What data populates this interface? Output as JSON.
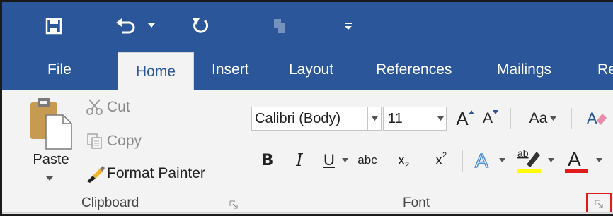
{
  "quick_access": {
    "save_icon": "save-icon",
    "undo_icon": "undo-icon",
    "redo_icon": "redo-icon",
    "disabled_icon": "touch-mode-icon",
    "customize_icon": "customize-qat-icon"
  },
  "tabs": [
    {
      "label": "File"
    },
    {
      "label": "Home",
      "active": true
    },
    {
      "label": "Insert"
    },
    {
      "label": "Layout"
    },
    {
      "label": "References"
    },
    {
      "label": "Mailings"
    },
    {
      "label": "Re"
    }
  ],
  "clipboard": {
    "paste_label": "Paste",
    "cut_label": "Cut",
    "copy_label": "Copy",
    "format_painter_label": "Format Painter",
    "group_label": "Clipboard"
  },
  "font": {
    "font_name": "Calibri (Body)",
    "font_size": "11",
    "grow_label": "A",
    "shrink_label": "A",
    "case_label": "Aa",
    "bold_label": "B",
    "italic_label": "I",
    "underline_label": "U",
    "strike_label": "abc",
    "sub_label": "x",
    "sub_index": "2",
    "sup_label": "x",
    "sup_index": "2",
    "effects_label": "A",
    "highlight_label": "ab",
    "color_label": "A",
    "group_label": "Font"
  },
  "colors": {
    "ribbon_blue": "#2b579a",
    "ribbon_bg": "#f3f3f3",
    "highlight_yellow": "#ffff00",
    "font_red": "#e01b1b",
    "callout_red": "#e01b1b"
  }
}
